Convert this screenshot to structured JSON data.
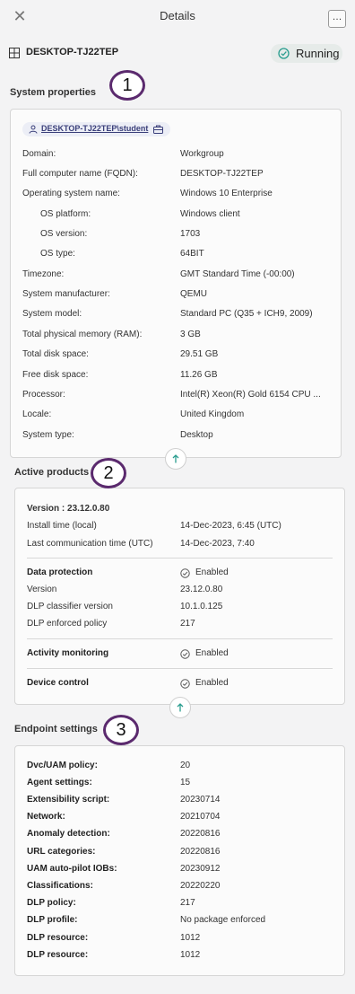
{
  "header": {
    "close_glyph": "✕",
    "title": "Details",
    "more_glyph": "…"
  },
  "device": {
    "name": "DESKTOP-TJ22TEP",
    "status": "Running"
  },
  "system_properties": {
    "title": "System properties",
    "user": "DESKTOP-TJ22TEP\\student",
    "rows": [
      {
        "label": "Domain:",
        "value": "Workgroup"
      },
      {
        "label": "Full computer name (FQDN):",
        "value": "DESKTOP-TJ22TEP"
      },
      {
        "label": "Operating system name:",
        "value": "Windows 10 Enterprise"
      },
      {
        "label": "OS platform:",
        "value": "Windows client"
      },
      {
        "label": "OS version:",
        "value": "1703"
      },
      {
        "label": "OS type:",
        "value": "64BIT"
      },
      {
        "label": "Timezone:",
        "value": "GMT Standard Time (-00:00)"
      },
      {
        "label": "System manufacturer:",
        "value": "QEMU"
      },
      {
        "label": "System model:",
        "value": "Standard PC (Q35 + ICH9, 2009)"
      },
      {
        "label": "Total physical memory (RAM):",
        "value": "3 GB"
      },
      {
        "label": "Total disk space:",
        "value": "29.51 GB"
      },
      {
        "label": "Free disk space:",
        "value": "11.26 GB"
      },
      {
        "label": "Processor:",
        "value": "Intel(R) Xeon(R) Gold 6154 CPU ..."
      },
      {
        "label": "Locale:",
        "value": "United Kingdom"
      },
      {
        "label": "System type:",
        "value": "Desktop"
      }
    ]
  },
  "active_products": {
    "title": "Active products",
    "version_line": "Version : 23.12.0.80",
    "install_label": "Install time (local)",
    "install_value": "14-Dec-2023, 6:45 (UTC)",
    "lastcomm_label": "Last communication time (UTC)",
    "lastcomm_value": "14-Dec-2023, 7:40",
    "data_protection_label": "Data protection",
    "data_protection_value": "Enabled",
    "version_label": "Version",
    "version_value": "23.12.0.80",
    "dlp_classifier_label": "DLP classifier version",
    "dlp_classifier_value": "10.1.0.125",
    "dlp_policy_label": "DLP enforced policy",
    "dlp_policy_value": "217",
    "activity_label": "Activity monitoring",
    "activity_value": "Enabled",
    "device_control_label": "Device control",
    "device_control_value": "Enabled"
  },
  "endpoint_settings": {
    "title": "Endpoint settings",
    "rows": [
      {
        "label": "Dvc/UAM policy:",
        "value": "20"
      },
      {
        "label": "Agent settings:",
        "value": "15"
      },
      {
        "label": "Extensibility script:",
        "value": "20230714"
      },
      {
        "label": "Network:",
        "value": "20210704"
      },
      {
        "label": "Anomaly detection:",
        "value": "20220816"
      },
      {
        "label": "URL categories:",
        "value": "20220816"
      },
      {
        "label": "UAM auto-pilot IOBs:",
        "value": "20230912"
      },
      {
        "label": "Classifications:",
        "value": "20220220"
      },
      {
        "label": "DLP policy:",
        "value": "217"
      },
      {
        "label": "DLP profile:",
        "value": "No package enforced"
      },
      {
        "label": "DLP resource:",
        "value": "1012"
      },
      {
        "label": "DLP resource:",
        "value": "1012"
      }
    ]
  },
  "callouts": [
    "1",
    "2",
    "3"
  ],
  "colors": {
    "accent_teal": "#2a9d8f",
    "callout_ring": "#5b2a6e",
    "user_link": "#3a3f7a"
  }
}
